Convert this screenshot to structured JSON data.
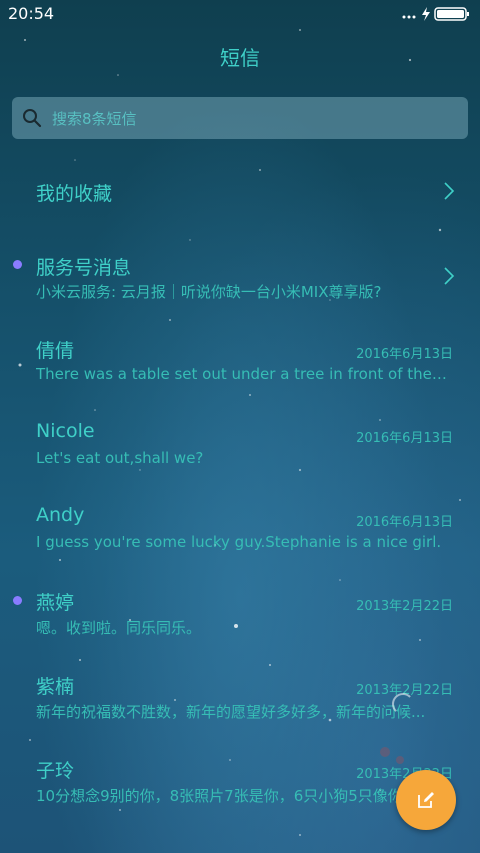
{
  "status_bar": {
    "time": "20:54",
    "icons": [
      "signal-dots-icon",
      "charging-icon",
      "battery-icon"
    ]
  },
  "header": {
    "title": "短信"
  },
  "search": {
    "placeholder": "搜索8条短信"
  },
  "favorites": {
    "label": "我的收藏"
  },
  "service": {
    "label": "服务号消息",
    "preview": "小米云服务: 云月报｜听说你缺一台小米MIX尊享版?",
    "unread": true
  },
  "conversations": [
    {
      "name": "倩倩",
      "date": "2016年6月13日",
      "preview": "There was a table set out under a tree in front of the ho...",
      "unread": false
    },
    {
      "name": "Nicole",
      "date": "2016年6月13日",
      "preview": "Let's eat out,shall we?",
      "unread": false
    },
    {
      "name": "Andy",
      "date": "2016年6月13日",
      "preview": "I guess you're some lucky guy.Stephanie is a nice girl.",
      "unread": false
    },
    {
      "name": "燕婷",
      "date": "2013年2月22日",
      "preview": "嗯。收到啦。同乐同乐。",
      "unread": true
    },
    {
      "name": "紫楠",
      "date": "2013年2月22日",
      "preview": "新年的祝福数不胜数，新年的愿望好多好多，新年的问候...",
      "unread": false
    },
    {
      "name": "子玲",
      "date": "2013年2月22日",
      "preview": "10分想念9别的你，8张照片7张是你，6只小狗5只像你...",
      "unread": false
    }
  ],
  "fab": {
    "icon": "compose-icon"
  },
  "colors": {
    "accent": "#3fd0c8",
    "fab": "#f6a73a",
    "unread_dot": "#8a7cff"
  }
}
